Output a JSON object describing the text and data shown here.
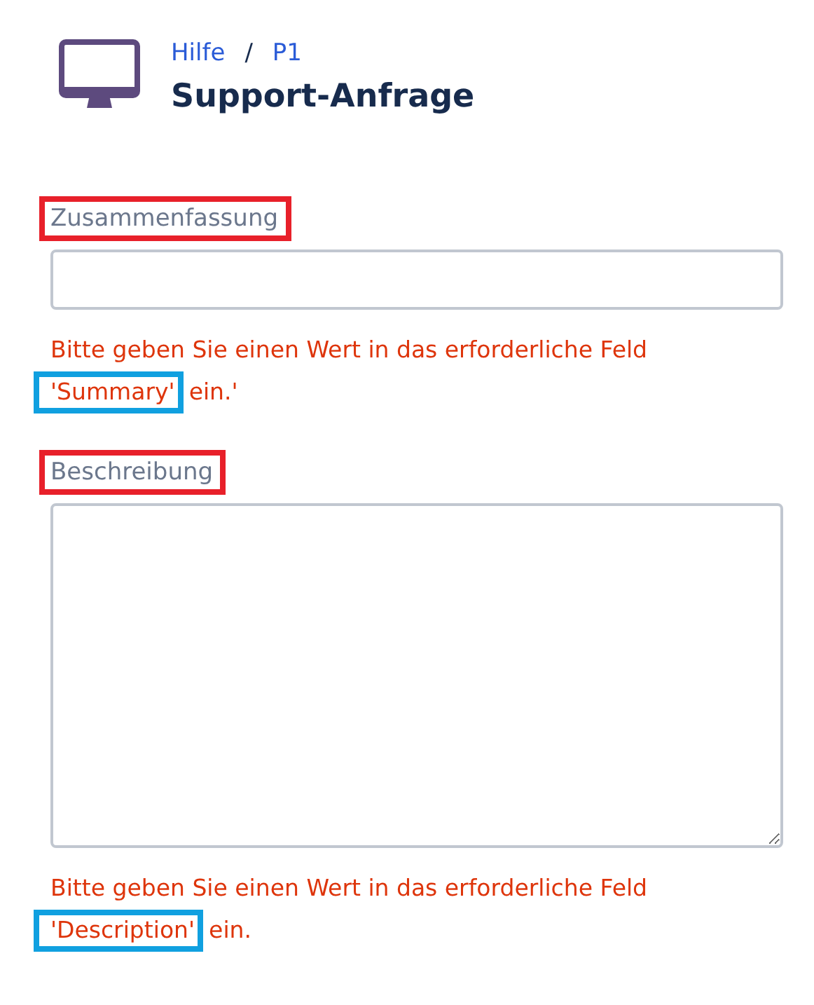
{
  "breadcrumb": {
    "items": [
      {
        "label": "Hilfe"
      },
      {
        "label": "P1"
      }
    ],
    "separator": "/"
  },
  "title": "Support-Anfrage",
  "fields": [
    {
      "kind": "input",
      "label": "Zusammenfassung",
      "label_highlighted": true,
      "error": {
        "text": "Bitte geben Sie einen Wert in das erforderliche Feld",
        "field_name": "'Summary'",
        "after": "ein.'",
        "field_name_highlighted": true
      }
    },
    {
      "kind": "textarea",
      "label": "Beschreibung",
      "label_highlighted": true,
      "error": {
        "text": "Bitte geben Sie einen Wert in das erforderliche Feld",
        "field_name": "'Description'",
        "after": "ein.",
        "field_name_highlighted": true
      }
    }
  ]
}
